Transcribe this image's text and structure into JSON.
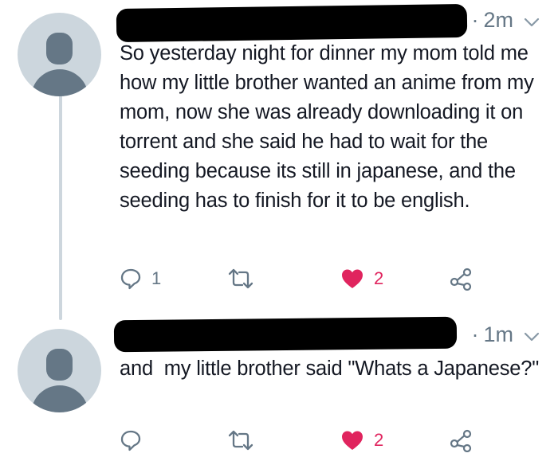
{
  "tweets": [
    {
      "time": "2m",
      "text": "So yesterday night for dinner my mom told me how my little brother wanted an anime from my mom, now she was already downloading it on torrent and she said he had to wait for the seeding because its still in japanese, and the seeding has to finish for it to be english.",
      "reply_count": "1",
      "retweet_count": "",
      "like_count": "2",
      "liked": true
    },
    {
      "time": "1m",
      "text": "and  my little brother said \"Whats a Japanese?\"",
      "reply_count": "",
      "retweet_count": "",
      "like_count": "2",
      "liked": true
    }
  ],
  "separator": "·",
  "colors": {
    "like": "#e0245e",
    "muted": "#657786",
    "avatar_bg": "#ccd6dd",
    "thread_line": "#cdd6dd"
  },
  "icons": [
    "reply-icon",
    "retweet-icon",
    "heart-icon",
    "share-icon",
    "chevron-down-icon"
  ]
}
